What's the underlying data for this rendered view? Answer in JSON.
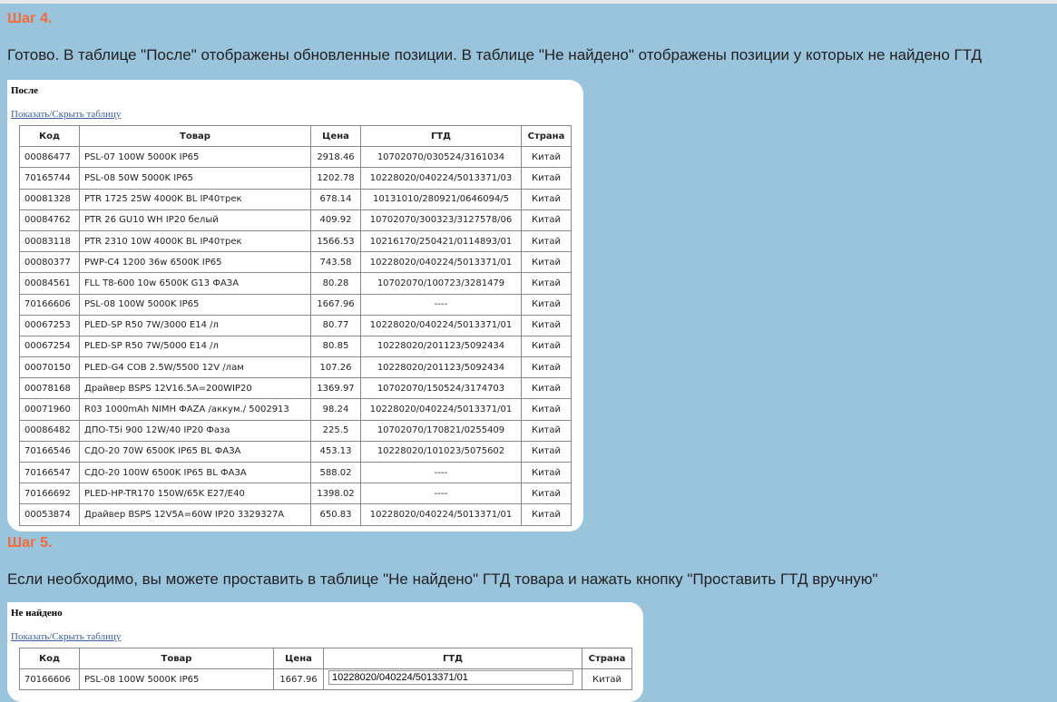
{
  "step4": {
    "title": "Шаг 4.",
    "text": "Готово. В таблице \"После\" отображены обновленные позиции. В таблице \"Не найдено\" отображены позиции у которых не найдено ГТД"
  },
  "after_table": {
    "title": "После",
    "toggle_label": "Показать/Скрыть таблицу",
    "headers": [
      "Код",
      "Товар",
      "Цена",
      "ГТД",
      "Страна"
    ],
    "rows": [
      [
        "00086477",
        "PSL-07 100W 5000K IP65",
        "2918.46",
        "10702070/030524/3161034",
        "Китай"
      ],
      [
        "70165744",
        "PSL-08 50W 5000K IP65",
        "1202.78",
        "10228020/040224/5013371/03",
        "Китай"
      ],
      [
        "00081328",
        "PTR 1725 25W 4000K BL IP40трек",
        "678.14",
        "10131010/280921/0646094/5",
        "Китай"
      ],
      [
        "00084762",
        "PTR 26 GU10 WH IP20 белый",
        "409.92",
        "10702070/300323/3127578/06",
        "Китай"
      ],
      [
        "00083118",
        "PTR 2310 10W 4000K BL IP40трек",
        "1566.53",
        "10216170/250421/0114893/01",
        "Китай"
      ],
      [
        "00080377",
        "PWP-C4 1200 36w 6500K IP65",
        "743.58",
        "10228020/040224/5013371/01",
        "Китай"
      ],
      [
        "00084561",
        "FLL T8-600 10w 6500K G13 ФАЗА",
        "80.28",
        "10702070/100723/3281479",
        "Китай"
      ],
      [
        "70166606",
        "PSL-08 100W 5000K IP65",
        "1667.96",
        "----",
        "Китай"
      ],
      [
        "00067253",
        "PLED-SP R50 7W/3000 E14 /л",
        "80.77",
        "10228020/040224/5013371/01",
        "Китай"
      ],
      [
        "00067254",
        "PLED-SP R50 7W/5000 E14 /л",
        "80.85",
        "10228020/201123/5092434",
        "Китай"
      ],
      [
        "00070150",
        "PLED-G4 COB 2.5W/5500 12V /лам",
        "107.26",
        "10228020/201123/5092434",
        "Китай"
      ],
      [
        "00078168",
        "Драйвер BSPS 12V16.5A=200WIP20",
        "1369.97",
        "10702070/150524/3174703",
        "Китай"
      ],
      [
        "00071960",
        "R03 1000mAh NIMH ФAZA /аккум./ 5002913",
        "98.24",
        "10228020/040224/5013371/01",
        "Китай"
      ],
      [
        "00086482",
        "ДПО-T5i 900 12W/40 IP20 Фаза",
        "225.5",
        "10702070/170821/0255409",
        "Китай"
      ],
      [
        "70166546",
        "СДО-20 70W 6500K IP65 BL ФАЗА",
        "453.13",
        "10228020/101023/5075602",
        "Китай"
      ],
      [
        "70166547",
        "СДО-20 100W 6500K IP65 BL ФАЗА",
        "588.02",
        "----",
        "Китай"
      ],
      [
        "70166692",
        "PLED-HP-TR170 150W/65K E27/E40",
        "1398.02",
        "----",
        "Китай"
      ],
      [
        "00053874",
        "Драйвер BSPS 12V5A=60W IP20 3329327A",
        "650.83",
        "10228020/040224/5013371/01",
        "Китай"
      ]
    ]
  },
  "step5": {
    "title": "Шаг 5.",
    "text": "Если необходимо, вы можете проставить в таблице \"Не найдено\" ГТД товара и нажать кнопку \"Проставить ГТД вручную\""
  },
  "notfound_table": {
    "title": "Не найдено",
    "toggle_label": "Показать/Скрыть таблицу",
    "headers": [
      "Код",
      "Товар",
      "Цена",
      "ГТД",
      "Страна"
    ],
    "rows": [
      [
        "70166606",
        "PSL-08 100W 5000K IP65",
        "1667.96",
        "10228020/040224/5013371/01",
        "Китай"
      ]
    ]
  }
}
